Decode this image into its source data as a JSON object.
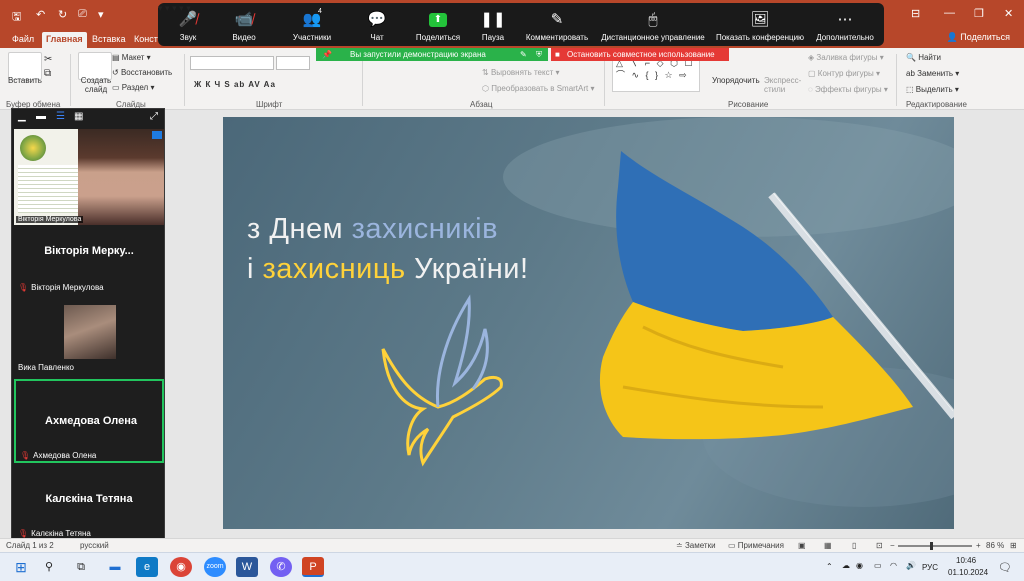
{
  "titlebar": {
    "qa_save": "🖫",
    "qa_undo": "↶",
    "qa_redo": "↻",
    "qa_pres": "⎚",
    "qa_more": "▾"
  },
  "tabs": [
    "Файл",
    "Главная",
    "Вставка",
    "Конст"
  ],
  "share_label": "Поделиться",
  "ribbon": {
    "paste": "Вставить",
    "clipboard_group": "Буфер обмена",
    "new_slide": "Создать слайд",
    "layout": "Макет",
    "reset": "Восстановить",
    "section": "Раздел",
    "slides_group": "Слайды",
    "font_group": "Шрифт",
    "font_styles": "Ж  К  Ч  S  ab  AV  Aa",
    "text_direction": "Выровнять текст",
    "smartart": "Преобразовать в SmartArt",
    "paragraph_group": "Абзац",
    "arrange": "Упорядочить",
    "quick_styles": "Экспресс-стили",
    "shape_fill": "Заливка фигуры",
    "shape_outline": "Контур фигуры",
    "shape_effects": "Эффекты фигуры",
    "drawing_group": "Рисование",
    "find": "Найти",
    "replace": "Заменить",
    "select": "Выделить",
    "editing_group": "Редактирование",
    "shapes_glyphs": "△ 〵 ⌐ ◇ ⬡ ☐ ⌒ ∿ { } ☆ ⇨"
  },
  "zoom_toolbar": {
    "items": [
      {
        "label": "Звук",
        "icon": "mic-muted-icon"
      },
      {
        "label": "Видео",
        "icon": "camera-off-icon"
      },
      {
        "label": "Участники",
        "icon": "participants-icon",
        "count": "4"
      },
      {
        "label": "Чат",
        "icon": "chat-icon"
      },
      {
        "label": "Поделиться",
        "icon": "share-screen-icon"
      },
      {
        "label": "Пауза",
        "icon": "pause-icon"
      },
      {
        "label": "Комментировать",
        "icon": "annotate-icon"
      },
      {
        "label": "Дистанционное управление",
        "icon": "remote-control-icon"
      },
      {
        "label": "Показать конференцию",
        "icon": "show-meeting-icon"
      },
      {
        "label": "Дополнительно",
        "icon": "more-icon"
      }
    ]
  },
  "banner": {
    "sharing": "Вы запустили демонстрацию экрана",
    "stop": "Остановить совместное использование"
  },
  "slide": {
    "line1_a": "з Днем ",
    "line1_b": "захисників",
    "line2_a": "і ",
    "line2_b": "захисниць",
    "line2_c": " України!"
  },
  "panel": {
    "video_tag": "Вікторія Меркулова",
    "participants": [
      {
        "big_name": "Вікторія Мерку...",
        "name": "Вікторія Меркулова"
      },
      {
        "big_name": "",
        "name": "Вика Павленко"
      },
      {
        "big_name": "Ахмедова Олена",
        "name": "Ахмедова Олена"
      },
      {
        "big_name": "Калєкіна Тетяна",
        "name": "Калєкіна Тетяна"
      }
    ]
  },
  "statusbar": {
    "slide_info": "Слайд 1 из 2",
    "language": "русский",
    "notes": "Заметки",
    "comments": "Примечания",
    "zoom": "86 %",
    "zoom_level": 0.43
  },
  "taskbar": {
    "lang": "РУС",
    "time": "10:46",
    "date": "01.10.2024"
  },
  "colors": {
    "powerpoint": "#b7472a",
    "zoom_bar": "#1a1a1a",
    "sharing_green": "#2ab24a",
    "stop_red": "#e53935",
    "active_speaker": "#22c55e",
    "flag_blue": "#2f6fb6",
    "flag_yellow": "#f5c518"
  }
}
